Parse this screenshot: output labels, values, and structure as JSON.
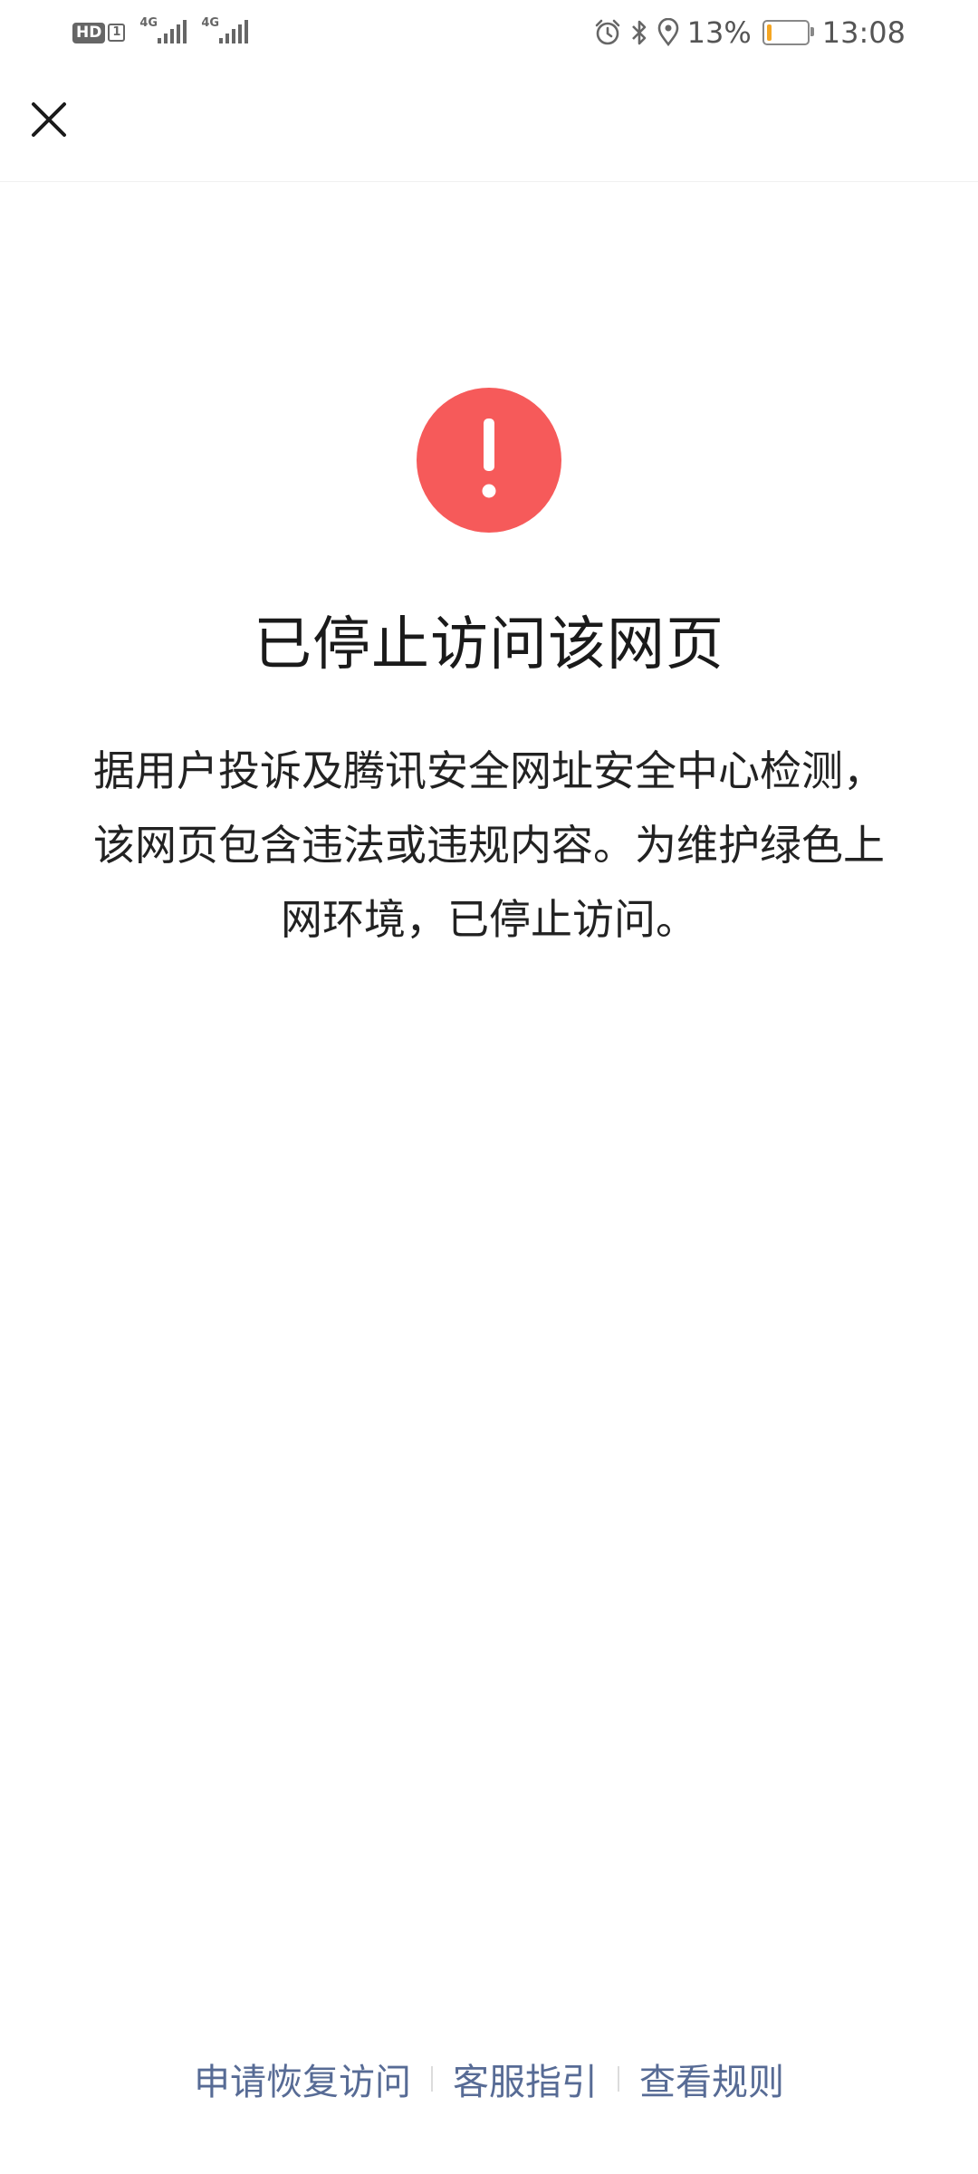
{
  "status_bar": {
    "hd_label": "HD",
    "hd_sim": "1",
    "network_1": "4G",
    "network_2": "4G",
    "battery_percent": "13%",
    "time": "13:08",
    "icons": [
      "alarm-icon",
      "bluetooth-icon",
      "location-icon",
      "battery-icon"
    ],
    "battery_level": 0.13,
    "battery_color": "#f5a623"
  },
  "top_bar": {
    "close_icon": "close-icon"
  },
  "main": {
    "alert_icon": "exclamation-icon",
    "alert_color": "#f65a5a",
    "title": "已停止访问该网页",
    "message": "据用户投诉及腾讯安全网址安全中心检测，该网页包含违法或违规内容。为维护绿色上网环境，已停止访问。"
  },
  "links": {
    "restore": "申请恢复访问",
    "service": "客服指引",
    "rules": "查看规则",
    "color": "#576b95"
  }
}
